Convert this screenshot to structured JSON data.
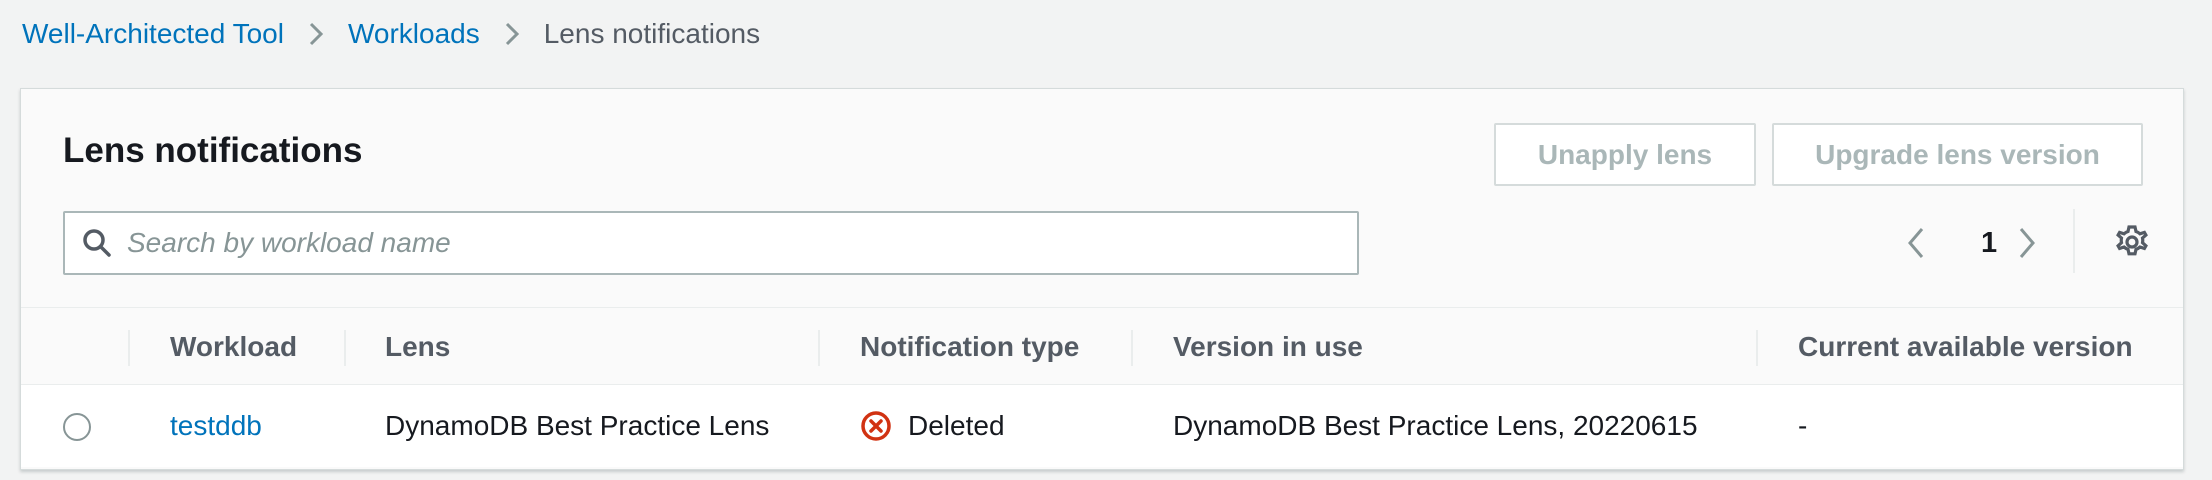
{
  "breadcrumb": {
    "items": [
      "Well-Architected Tool",
      "Workloads"
    ],
    "current": "Lens notifications"
  },
  "panel": {
    "title": "Lens notifications",
    "unapply_label": "Unapply lens",
    "upgrade_label": "Upgrade lens version"
  },
  "search": {
    "placeholder": "Search by workload name",
    "value": ""
  },
  "pagination": {
    "current_page": "1"
  },
  "table": {
    "columns": [
      "Workload",
      "Lens",
      "Notification type",
      "Version in use",
      "Current available version"
    ],
    "rows": [
      {
        "workload": "testddb",
        "lens": "DynamoDB Best Practice Lens",
        "notification_type": "Deleted",
        "version_in_use": "DynamoDB Best Practice Lens, 20220615",
        "current_available_version": "-"
      }
    ]
  },
  "icons": {
    "breadcrumb_separator": "chevron-right-icon",
    "search": "search-icon",
    "prev": "chevron-left-icon",
    "next": "chevron-right-icon",
    "settings": "gear-icon",
    "status_deleted": "error-x-circle-icon"
  },
  "colors": {
    "link": "#0073bb",
    "error": "#d13212",
    "disabled_text": "#aab7b8",
    "background": "#f2f3f3"
  }
}
